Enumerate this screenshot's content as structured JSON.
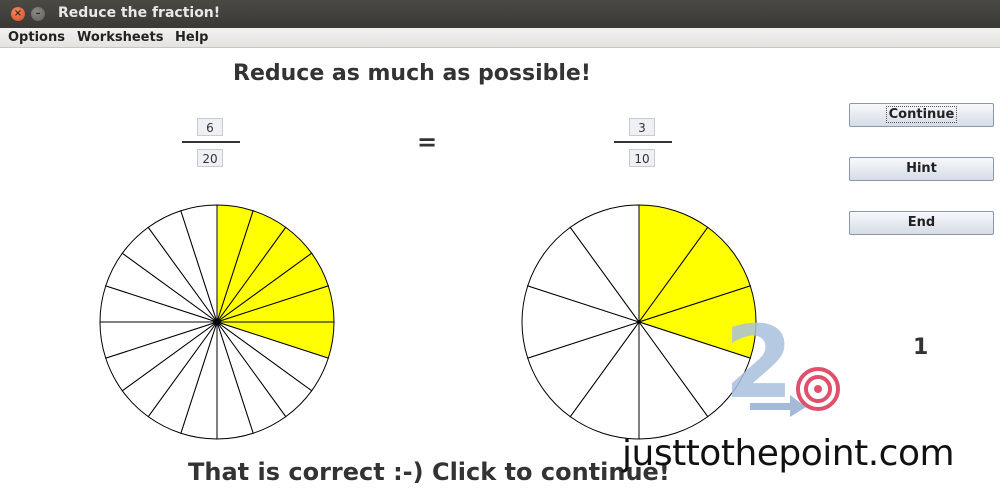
{
  "window": {
    "title": "Reduce the fraction!",
    "close_glyph": "×",
    "min_glyph": "–"
  },
  "menu": [
    "Options",
    "Worksheets",
    "Help"
  ],
  "headline": "Reduce as much as possible!",
  "fraction_left": {
    "numerator": "6",
    "denominator": "20"
  },
  "equals": "=",
  "fraction_right": {
    "numerator": "3",
    "denominator": "10"
  },
  "pie_left": {
    "slices": 20,
    "filled": 6
  },
  "pie_right": {
    "slices": 10,
    "filled": 3
  },
  "buttons": {
    "continue": "Continue",
    "hint": "Hint",
    "end": "End"
  },
  "counter": "1",
  "status": "That is correct :-) Click to continue!",
  "watermark": {
    "logo_text": "2",
    "site": "justtothepoint.com"
  },
  "colors": {
    "fill": "#ffff00",
    "title_bar": "#3c3b37",
    "logo_blue": "#9fb8d8",
    "logo_red": "#e0506a"
  }
}
